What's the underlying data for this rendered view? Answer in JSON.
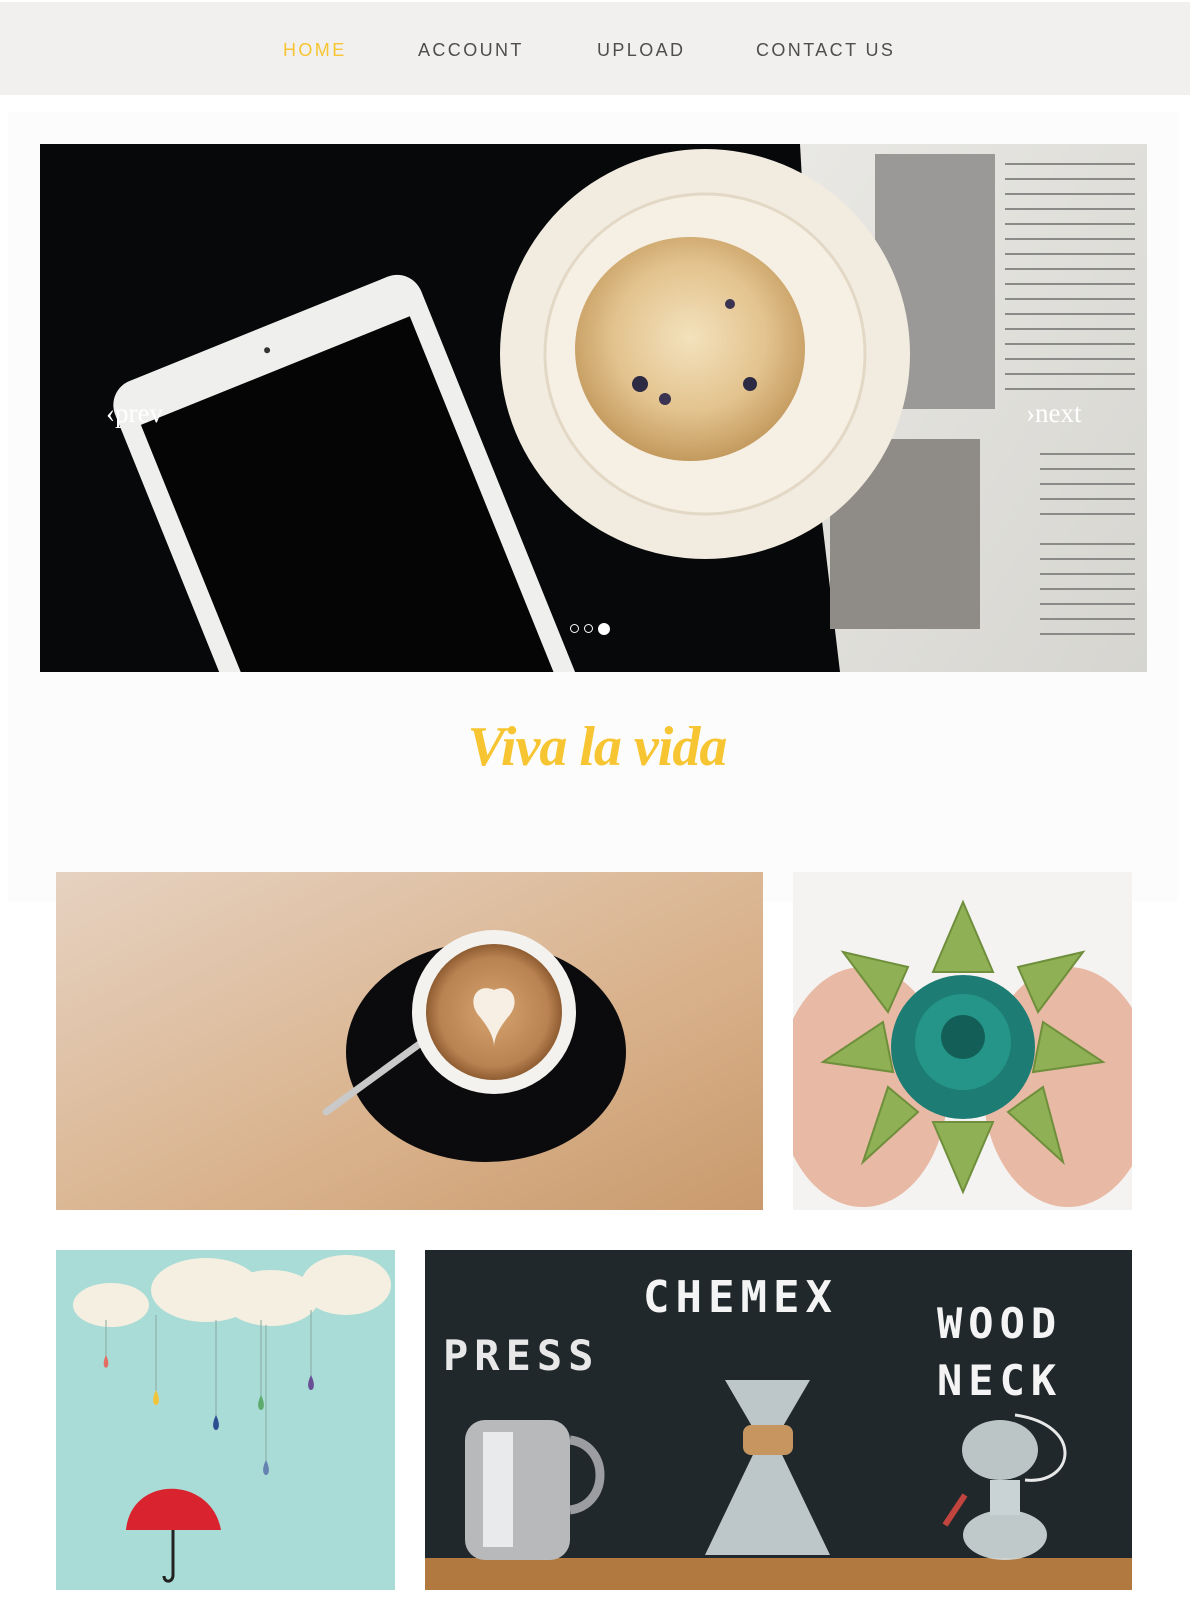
{
  "nav": {
    "items": [
      {
        "label": "HOME",
        "active": true
      },
      {
        "label": "ACCOUNT",
        "active": false
      },
      {
        "label": "UPLOAD",
        "active": false
      },
      {
        "label": "CONTACT US",
        "active": false
      }
    ]
  },
  "slider": {
    "prev_label": "‹prev",
    "next_label": "›next",
    "slide_count": 3,
    "active_slide": 3
  },
  "tagline": "Viva la vida",
  "gallery": {
    "chalkboard_words": [
      "CHEMEX",
      "PRESS",
      "WOOD",
      "NECK"
    ]
  },
  "colors": {
    "accent": "#f7c531",
    "nav_bg": "#f1f0ef",
    "nav_text": "#4e4e4e"
  }
}
